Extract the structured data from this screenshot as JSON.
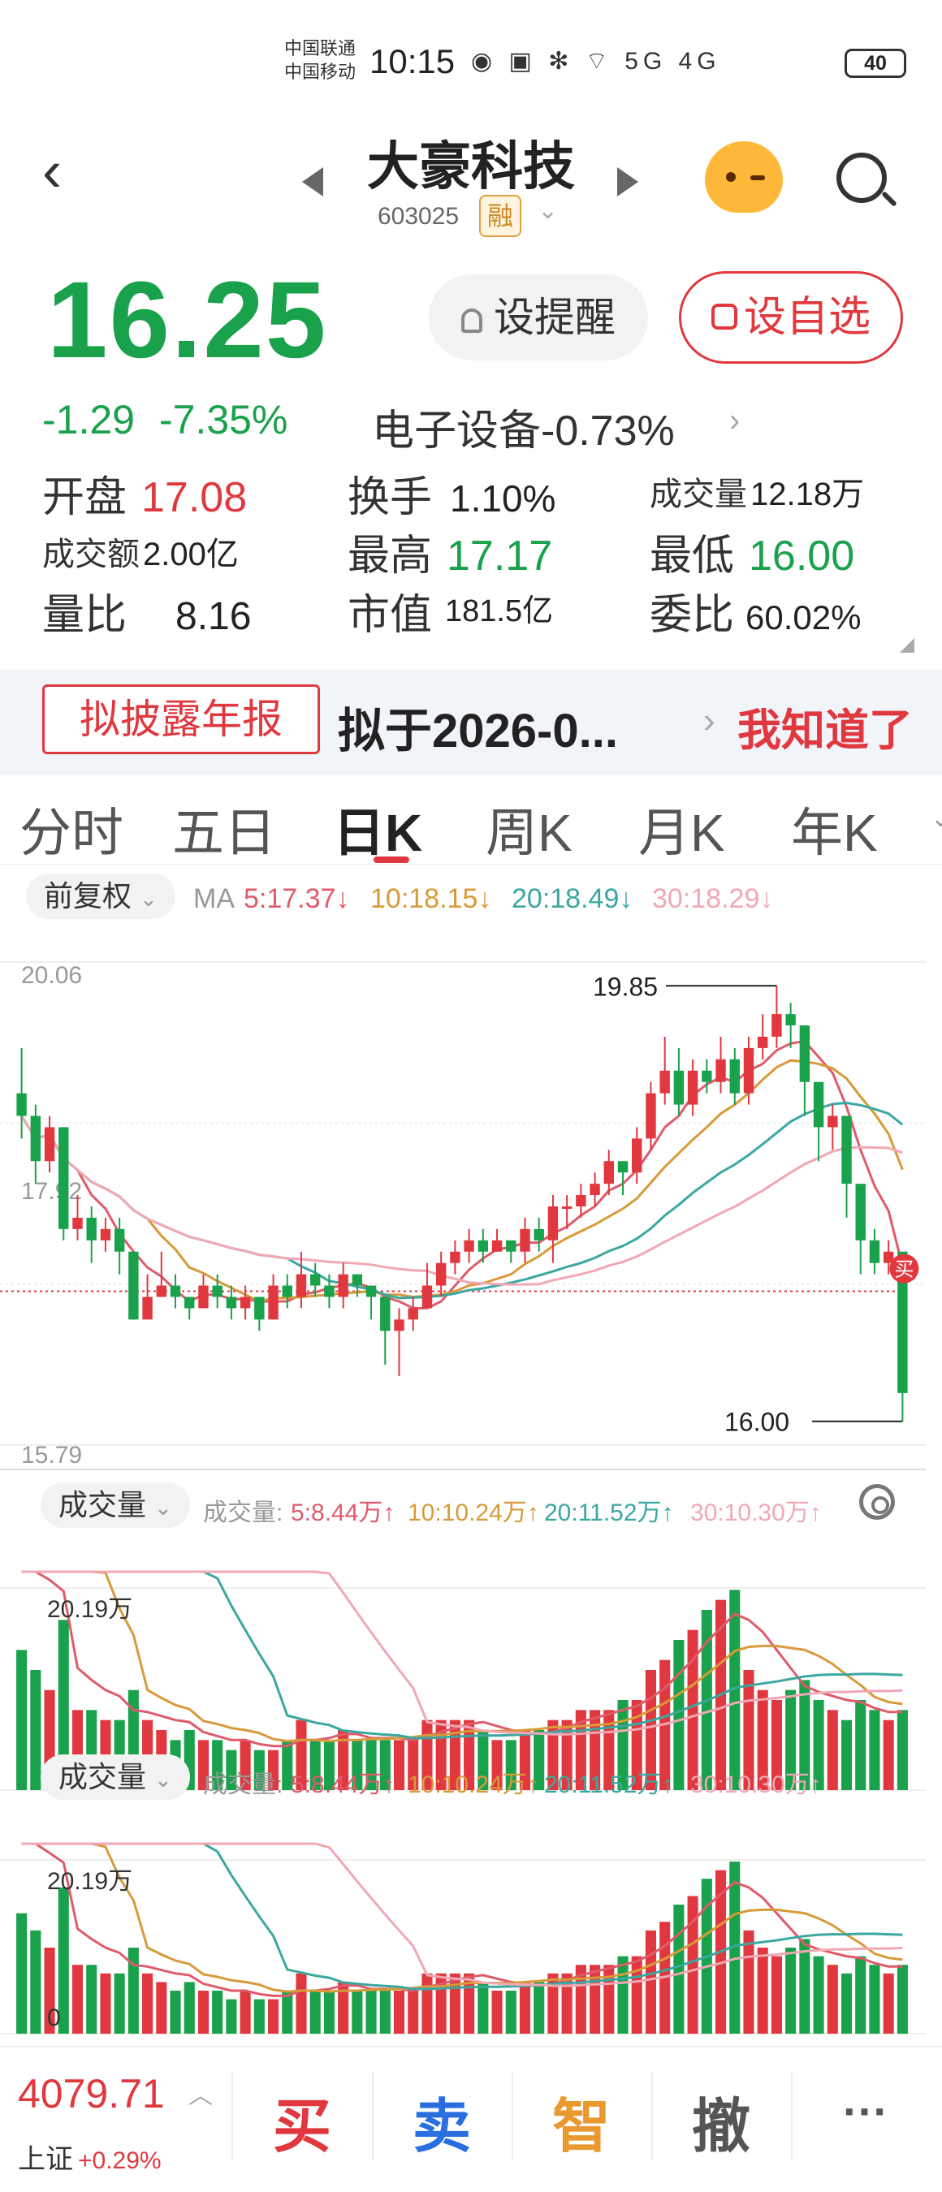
{
  "status_bar": {
    "carrier1": "中国联通",
    "carrier2": "中国移动",
    "time": "10:15",
    "icons": "◉ ▣ ✻ ⌔ 5G 4G",
    "battery": "40"
  },
  "header": {
    "stock_name": "大豪科技",
    "stock_code": "603025",
    "margin_badge": "融"
  },
  "quote": {
    "price": "16.25",
    "change": "-1.29",
    "change_pct": "-7.35%",
    "sector": "电子设备-0.73%",
    "alert_label": "设提醒",
    "watchlist_label": "设自选",
    "stats": [
      {
        "label": "开盘",
        "value": "17.08"
      },
      {
        "label": "换手",
        "value": "1.10%"
      },
      {
        "label": "成交量",
        "value": "12.18万"
      },
      {
        "label": "成交额",
        "value": "2.00亿"
      },
      {
        "label": "最高",
        "value": "17.17"
      },
      {
        "label": "最低",
        "value": "16.00"
      },
      {
        "label": "量比",
        "value": "8.16"
      },
      {
        "label": "市值",
        "value": "181.5亿"
      },
      {
        "label": "委比",
        "value": "60.02%"
      }
    ]
  },
  "notice": {
    "tag": "拟披露年报",
    "text": "拟于2026-0...",
    "dismiss": "我知道了"
  },
  "tabs": [
    "分时",
    "五日",
    "日K",
    "周K",
    "月K",
    "年K"
  ],
  "kline": {
    "adjust_label": "前复权",
    "ma_prefix": "MA",
    "ma5": "5:17.37↓",
    "ma10": "10:18.15↓",
    "ma20": "20:18.49↓",
    "ma30": "30:18.29↓",
    "y_top": "20.06",
    "y_mid": "17.92",
    "y_bottom": "15.79",
    "max_label": "19.85",
    "min_label": "16.00",
    "buy_marker": "买"
  },
  "volume": {
    "label": "成交量",
    "prefix": "成交量:",
    "ma5": "5:8.44万↑",
    "ma10": "10:10.24万↑",
    "ma20": "20:11.52万↑",
    "ma30": "30:10.30万↑",
    "y_top": "20.19万",
    "y_zero": "0"
  },
  "bottom": {
    "index_value": "4079.71",
    "index_name": "上证",
    "index_pct": "+0.29%",
    "buy": "买",
    "sell": "卖",
    "smart": "智",
    "cancel": "撤",
    "more": "···"
  },
  "colors": {
    "up": "#e0383e",
    "down": "#19a14b",
    "ma5": "#e05a6a",
    "ma10": "#d89a3a",
    "ma20": "#3aa8a0",
    "ma30": "#f0a8b4"
  },
  "chart_data": {
    "type": "candlestick",
    "ohlc": [
      [
        18.9,
        18.7,
        19.3,
        18.5
      ],
      [
        18.7,
        18.3,
        18.8,
        18.1
      ],
      [
        18.3,
        18.6,
        18.7,
        18.2
      ],
      [
        18.6,
        17.7,
        18.6,
        17.6
      ],
      [
        17.7,
        17.8,
        18.0,
        17.6
      ],
      [
        17.8,
        17.6,
        17.9,
        17.4
      ],
      [
        17.6,
        17.7,
        17.8,
        17.5
      ],
      [
        17.7,
        17.5,
        17.8,
        17.3
      ],
      [
        17.5,
        16.9,
        17.5,
        16.9
      ],
      [
        16.9,
        17.1,
        17.3,
        17.0
      ],
      [
        17.1,
        17.2,
        17.5,
        17.1
      ],
      [
        17.2,
        17.1,
        17.3,
        17.0
      ],
      [
        17.1,
        17.0,
        17.1,
        16.9
      ],
      [
        17.0,
        17.2,
        17.3,
        17.0
      ],
      [
        17.2,
        17.1,
        17.3,
        17.0
      ],
      [
        17.1,
        17.0,
        17.2,
        16.9
      ],
      [
        17.0,
        17.1,
        17.2,
        16.9
      ],
      [
        17.1,
        16.9,
        17.1,
        16.8
      ],
      [
        16.9,
        17.2,
        17.3,
        16.9
      ],
      [
        17.2,
        17.1,
        17.3,
        17.0
      ],
      [
        17.1,
        17.3,
        17.5,
        17.0
      ],
      [
        17.3,
        17.2,
        17.4,
        17.1
      ],
      [
        17.2,
        17.1,
        17.3,
        17.0
      ],
      [
        17.1,
        17.3,
        17.4,
        17.0
      ],
      [
        17.3,
        17.2,
        17.3,
        17.1
      ],
      [
        17.2,
        17.1,
        17.2,
        16.9
      ],
      [
        17.1,
        16.8,
        17.1,
        16.5
      ],
      [
        16.8,
        16.9,
        17.0,
        16.4
      ],
      [
        16.9,
        17.0,
        17.1,
        16.8
      ],
      [
        17.0,
        17.2,
        17.4,
        17.0
      ],
      [
        17.2,
        17.4,
        17.5,
        17.1
      ],
      [
        17.4,
        17.5,
        17.6,
        17.3
      ],
      [
        17.5,
        17.6,
        17.7,
        17.4
      ],
      [
        17.6,
        17.5,
        17.7,
        17.4
      ],
      [
        17.5,
        17.6,
        17.7,
        17.5
      ],
      [
        17.6,
        17.5,
        17.6,
        17.4
      ],
      [
        17.5,
        17.7,
        17.8,
        17.4
      ],
      [
        17.7,
        17.6,
        17.8,
        17.5
      ],
      [
        17.6,
        17.9,
        18.0,
        17.4
      ],
      [
        17.9,
        17.9,
        18.0,
        17.7
      ],
      [
        17.9,
        18.0,
        18.1,
        17.8
      ],
      [
        18.0,
        18.1,
        18.2,
        17.9
      ],
      [
        18.1,
        18.3,
        18.4,
        18.0
      ],
      [
        18.3,
        18.2,
        18.3,
        18.0
      ],
      [
        18.2,
        18.5,
        18.6,
        18.1
      ],
      [
        18.5,
        18.9,
        19.0,
        18.4
      ],
      [
        18.9,
        19.1,
        19.4,
        18.8
      ],
      [
        19.1,
        18.8,
        19.3,
        18.7
      ],
      [
        18.8,
        19.1,
        19.2,
        18.7
      ],
      [
        19.1,
        19.0,
        19.2,
        18.9
      ],
      [
        19.0,
        19.2,
        19.4,
        18.9
      ],
      [
        19.2,
        18.9,
        19.3,
        18.8
      ],
      [
        18.9,
        19.3,
        19.4,
        18.8
      ],
      [
        19.3,
        19.4,
        19.6,
        19.2
      ],
      [
        19.4,
        19.6,
        19.85,
        19.3
      ],
      [
        19.6,
        19.5,
        19.7,
        19.3
      ],
      [
        19.5,
        19.0,
        19.5,
        18.7
      ],
      [
        19.0,
        18.6,
        19.0,
        18.3
      ],
      [
        18.6,
        18.7,
        18.8,
        18.4
      ],
      [
        18.7,
        18.1,
        18.7,
        17.8
      ],
      [
        18.1,
        17.6,
        18.1,
        17.3
      ],
      [
        17.6,
        17.4,
        17.7,
        17.3
      ],
      [
        17.4,
        17.5,
        17.6,
        17.3
      ],
      [
        17.5,
        16.25,
        17.17,
        16.0
      ]
    ],
    "volume_values": [
      14,
      12,
      10,
      17,
      8,
      8,
      7,
      7,
      10,
      7,
      6,
      5,
      6,
      5,
      5,
      4,
      5,
      4,
      4,
      5,
      7,
      5,
      5,
      6,
      5,
      5,
      5,
      5,
      5,
      7,
      7,
      7,
      7,
      6,
      5,
      5,
      6,
      6,
      7,
      7,
      8,
      8,
      8,
      9,
      9,
      12,
      13,
      15,
      16,
      18,
      19,
      20,
      12,
      10,
      9,
      10,
      11,
      9,
      8,
      7,
      9,
      8,
      7,
      8
    ],
    "y_range": [
      15.79,
      20.06
    ],
    "max_price": 19.85,
    "min_price": 16.0,
    "current_price": 16.25
  }
}
